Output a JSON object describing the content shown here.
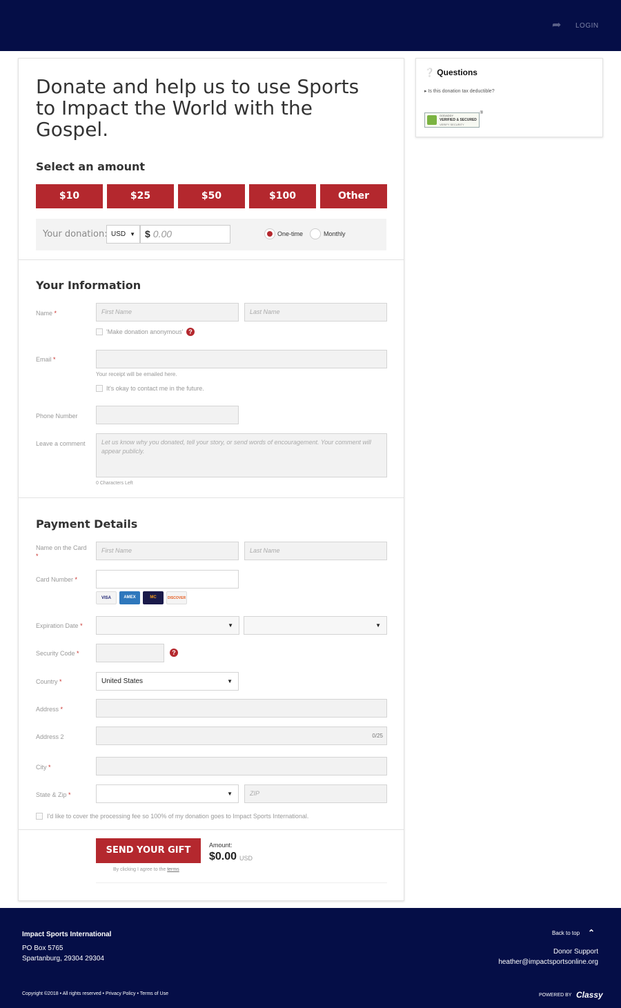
{
  "header": {
    "login_label": "LOGIN",
    "share_icon": "share-arrow-icon"
  },
  "hero": {
    "headline": "Donate and help us to use Sports to Impact the World with the Gospel."
  },
  "amount_section": {
    "title": "Select an amount",
    "options": [
      "$10",
      "$25",
      "$50",
      "$100",
      "Other"
    ],
    "donation_label": "Your donation:",
    "currency": "USD",
    "currency_symbol": "$",
    "amount_placeholder": "0.00",
    "frequency": {
      "one_time": "One-time",
      "monthly": "Monthly",
      "selected": "One-time"
    }
  },
  "info_section": {
    "title": "Your Information",
    "name_label": "Name",
    "first_name_placeholder": "First Name",
    "last_name_placeholder": "Last Name",
    "anonymous_label": "'Make donation anonymous'",
    "email_label": "Email",
    "email_note": "Your receipt will be emailed here.",
    "contact_label": "It's okay to contact me in the future.",
    "phone_label": "Phone Number",
    "comment_label": "Leave a comment",
    "comment_placeholder": "Let us know why you donated, tell your story, or send words of encouragement. Your comment will appear publicly.",
    "chars_left": "0 Characters Left",
    "required_mark": "*"
  },
  "payment_section": {
    "title": "Payment Details",
    "name_on_card_label": "Name on the Card",
    "first_name_placeholder": "First Name",
    "last_name_placeholder": "Last Name",
    "card_number_label": "Card Number",
    "cards": [
      "VISA",
      "AMEX",
      "MC",
      "DISCOVER"
    ],
    "expiration_label": "Expiration Date",
    "security_code_label": "Security Code",
    "country_label": "Country",
    "country_value": "United States",
    "address_label": "Address",
    "address2_label": "Address 2",
    "address2_counter": "0/25",
    "city_label": "City",
    "state_zip_label": "State & Zip",
    "zip_placeholder": "ZIP",
    "fee_label": "I'd like to cover the processing fee so 100% of my donation goes to Impact Sports International."
  },
  "submit": {
    "button_label": "SEND YOUR GIFT",
    "agree_text": "By clicking I agree to the",
    "terms_link": "terms",
    "amount_label": "Amount:",
    "amount_value": "$0.00",
    "amount_currency": "USD"
  },
  "sidebar": {
    "questions_title": "Questions",
    "question_link": "Is this donation tax deductible?",
    "badge": {
      "line1": "GODADDY",
      "line2": "VERIFIED & SECURED",
      "line3": "VERIFY SECURITY",
      "reg": "®"
    }
  },
  "footer": {
    "org_name": "Impact Sports International",
    "address_line1": "PO Box 5765",
    "address_line2": "Spartanburg, 29304 29304",
    "copyright": "Copyright ©2018 • All rights reserved • Privacy Policy • Terms of Use",
    "back_to_top": "Back to top",
    "donor_support": "Donor Support",
    "email": "heather@impactsportsonline.org",
    "powered_by": "POWERED BY",
    "brand": "Classy"
  },
  "colors": {
    "navy": "#050e47",
    "accent_red": "#b4282e"
  }
}
